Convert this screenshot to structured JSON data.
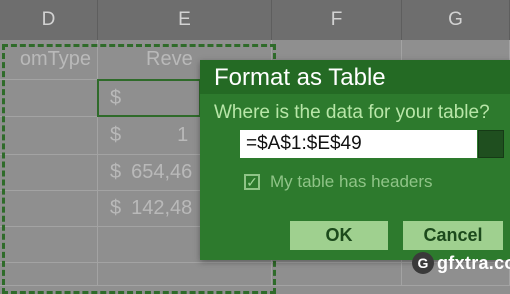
{
  "sheet": {
    "columns": [
      "D",
      "E",
      "F",
      "G"
    ],
    "headers": {
      "d": "omType",
      "e": "Reve"
    },
    "rows": [
      {
        "symbol": "$",
        "value": ""
      },
      {
        "symbol": "$",
        "value": "1"
      },
      {
        "symbol": "$",
        "value": "654,46"
      },
      {
        "symbol": "$",
        "value": "142,48"
      }
    ]
  },
  "dialog": {
    "title": "Format as Table",
    "question": "Where is the data for your table?",
    "range_value": "=$A$1:$E$49",
    "headers_checkbox_label": "My table has headers",
    "headers_checked": true,
    "ok_label": "OK",
    "cancel_label": "Cancel"
  },
  "watermark": {
    "circle_letter": "G",
    "text": "gfxtra.com"
  },
  "colors": {
    "dialog_bg": "#2d7a2d",
    "dialog_title_bg": "#246a24",
    "button_bg": "#9fd08f",
    "sheet_bg": "#8f8f8f",
    "marquee": "#2f6b2a"
  }
}
